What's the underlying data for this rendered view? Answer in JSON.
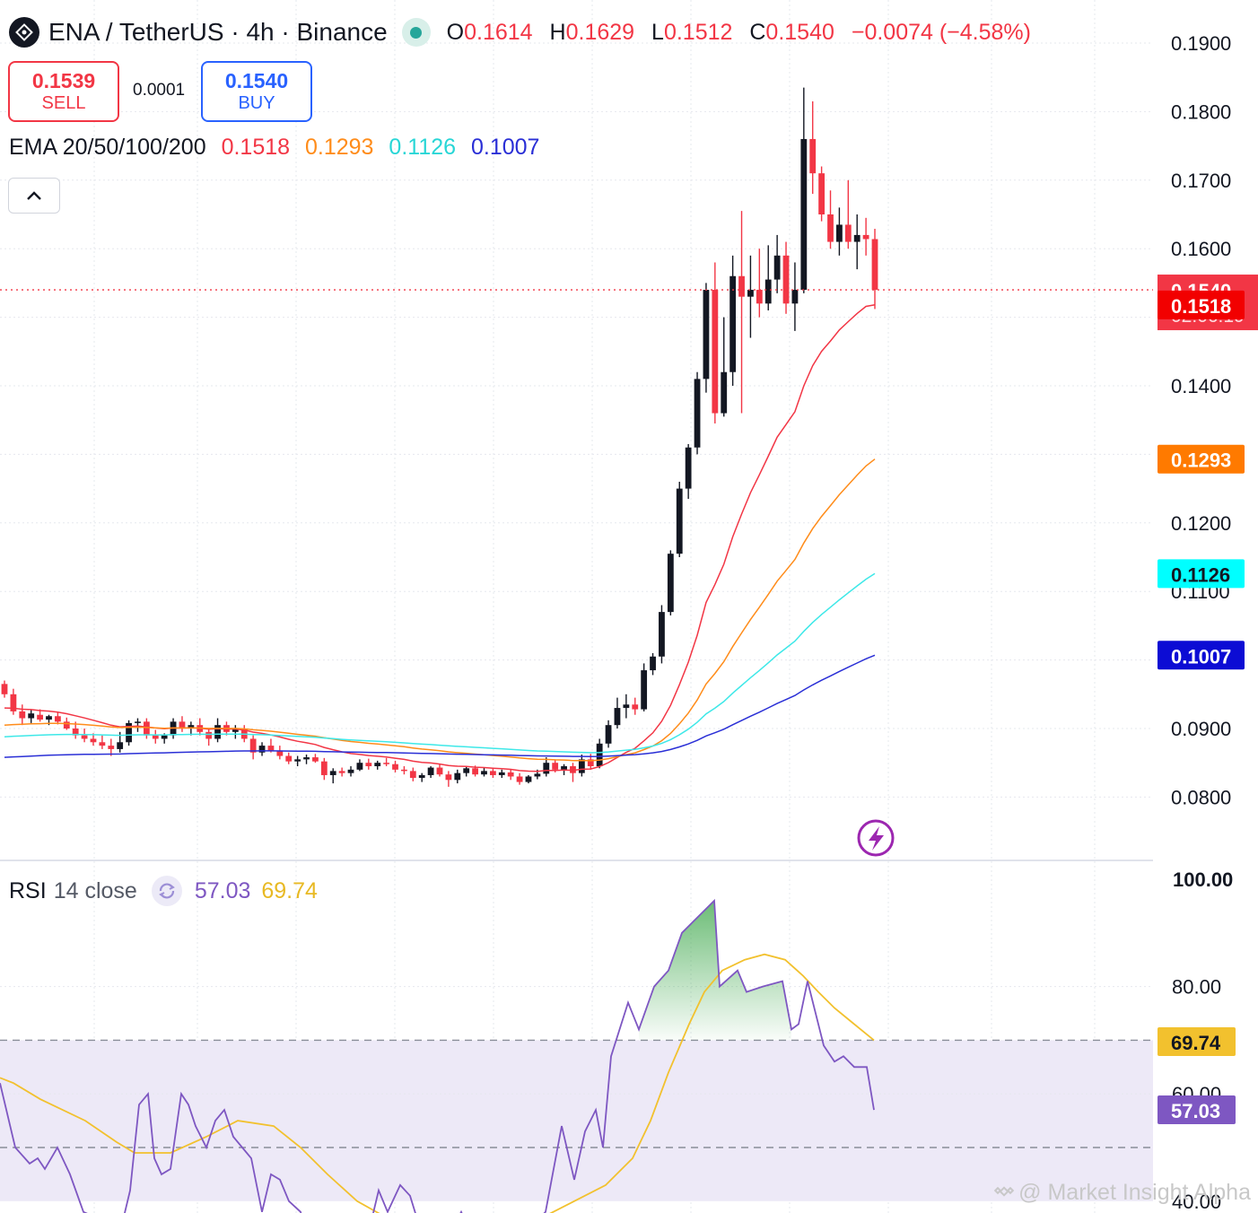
{
  "header": {
    "symbol": "ENA",
    "pair": "ENA / TetherUS · 4h · Binance",
    "ohlc": [
      {
        "k": "O",
        "v": "0.1614"
      },
      {
        "k": "H",
        "v": "0.1629"
      },
      {
        "k": "L",
        "v": "0.1512"
      },
      {
        "k": "C",
        "v": "0.1540"
      }
    ],
    "change": "−0.0074 (−4.58%)"
  },
  "trade": {
    "sell_price": "0.1539",
    "sell_label": "SELL",
    "spread": "0.0001",
    "buy_price": "0.1540",
    "buy_label": "BUY"
  },
  "ema_legend": {
    "label": "EMA 20/50/100/200",
    "values": [
      "0.1518",
      "0.1293",
      "0.1126",
      "0.1007"
    ]
  },
  "rsi_legend": {
    "name": "RSI",
    "args": "14 close",
    "rsi": "57.03",
    "ma": "69.74"
  },
  "watermark": "@ Market Insight Alpha",
  "colors": {
    "up": "#131722",
    "down": "#f23645",
    "ema20": "#f23645",
    "ema50": "#ff8c1a",
    "ema100": "#3ee8e8",
    "ema200": "#2a2fd6",
    "rsi": "#7e57c2",
    "rsi_ma": "#f2c12e",
    "rsi_band": "#ede9f7"
  },
  "icons": [
    "exchange-logo-icon",
    "status-dot-icon",
    "chevron-up-icon",
    "refresh-icon",
    "lightning-icon",
    "binance-logo-icon"
  ],
  "chart_data": [
    {
      "type": "candlestick",
      "ylim": [
        0.073,
        0.195
      ],
      "yticks": [
        "0.1900",
        "0.1800",
        "0.1700",
        "0.1600",
        "0.1400",
        "0.1200",
        "0.1100",
        "0.0900",
        "0.0800"
      ],
      "price_badges": [
        {
          "label": "0.1540",
          "sub": "02:06:19",
          "value": 0.154,
          "color": "#f23645"
        },
        {
          "label": "0.1518",
          "value": 0.1518,
          "color": "#f20000"
        },
        {
          "label": "0.1293",
          "value": 0.1293,
          "color": "#ff7a00"
        },
        {
          "label": "0.1126",
          "value": 0.1126,
          "color": "#00ffff"
        },
        {
          "label": "0.1007",
          "value": 0.1007,
          "color": "#0c0cd4"
        }
      ],
      "candles_ohlc": [
        [
          0.0965,
          0.097,
          0.0945,
          0.095
        ],
        [
          0.095,
          0.0958,
          0.092,
          0.0925
        ],
        [
          0.0925,
          0.0935,
          0.0905,
          0.0915
        ],
        [
          0.0915,
          0.0928,
          0.0908,
          0.0922
        ],
        [
          0.092,
          0.0928,
          0.091,
          0.0913
        ],
        [
          0.0913,
          0.092,
          0.0905,
          0.0918
        ],
        [
          0.0918,
          0.0924,
          0.0906,
          0.091
        ],
        [
          0.091,
          0.0916,
          0.0898,
          0.09
        ],
        [
          0.09,
          0.091,
          0.0885,
          0.089
        ],
        [
          0.089,
          0.09,
          0.088,
          0.0885
        ],
        [
          0.0885,
          0.0893,
          0.0875,
          0.088
        ],
        [
          0.088,
          0.089,
          0.087,
          0.0875
        ],
        [
          0.0875,
          0.0885,
          0.086,
          0.087
        ],
        [
          0.087,
          0.0895,
          0.0865,
          0.088
        ],
        [
          0.088,
          0.0912,
          0.0875,
          0.0908
        ],
        [
          0.0908,
          0.0915,
          0.0895,
          0.091
        ],
        [
          0.091,
          0.0915,
          0.0885,
          0.089
        ],
        [
          0.089,
          0.0898,
          0.0878,
          0.0885
        ],
        [
          0.0885,
          0.0893,
          0.0878,
          0.089
        ],
        [
          0.089,
          0.0915,
          0.0885,
          0.091
        ],
        [
          0.091,
          0.0918,
          0.0895,
          0.09
        ],
        [
          0.09,
          0.091,
          0.089,
          0.0905
        ],
        [
          0.0905,
          0.0915,
          0.089,
          0.0895
        ],
        [
          0.0895,
          0.09,
          0.0875,
          0.0885
        ],
        [
          0.0885,
          0.0915,
          0.088,
          0.0905
        ],
        [
          0.0905,
          0.091,
          0.089,
          0.0895
        ],
        [
          0.0895,
          0.0905,
          0.0885,
          0.09
        ],
        [
          0.09,
          0.0905,
          0.088,
          0.0885
        ],
        [
          0.0885,
          0.089,
          0.0855,
          0.0865
        ],
        [
          0.0865,
          0.088,
          0.086,
          0.0875
        ],
        [
          0.0875,
          0.0885,
          0.0865,
          0.0868
        ],
        [
          0.0868,
          0.0875,
          0.0855,
          0.086
        ],
        [
          0.086,
          0.0865,
          0.0848,
          0.0852
        ],
        [
          0.0852,
          0.086,
          0.0845,
          0.0855
        ],
        [
          0.0855,
          0.0862,
          0.0848,
          0.0858
        ],
        [
          0.0858,
          0.0863,
          0.085,
          0.0852
        ],
        [
          0.0852,
          0.0857,
          0.0825,
          0.0832
        ],
        [
          0.0832,
          0.0842,
          0.082,
          0.0838
        ],
        [
          0.0838,
          0.0843,
          0.083,
          0.0835
        ],
        [
          0.0835,
          0.0845,
          0.083,
          0.084
        ],
        [
          0.084,
          0.0855,
          0.0838,
          0.085
        ],
        [
          0.085,
          0.0856,
          0.084,
          0.0845
        ],
        [
          0.0845,
          0.0853,
          0.084,
          0.085
        ],
        [
          0.085,
          0.0857,
          0.0845,
          0.0848
        ],
        [
          0.0848,
          0.0853,
          0.0836,
          0.084
        ],
        [
          0.084,
          0.0845,
          0.0833,
          0.0838
        ],
        [
          0.0838,
          0.0843,
          0.0823,
          0.0828
        ],
        [
          0.0828,
          0.0835,
          0.0822,
          0.0832
        ],
        [
          0.0832,
          0.0845,
          0.0828,
          0.0843
        ],
        [
          0.0843,
          0.0848,
          0.083,
          0.0833
        ],
        [
          0.0833,
          0.0838,
          0.0815,
          0.0825
        ],
        [
          0.0825,
          0.084,
          0.082,
          0.0835
        ],
        [
          0.0835,
          0.0845,
          0.083,
          0.0842
        ],
        [
          0.0842,
          0.0846,
          0.083,
          0.0833
        ],
        [
          0.0833,
          0.0843,
          0.083,
          0.0838
        ],
        [
          0.0838,
          0.0843,
          0.0828,
          0.0832
        ],
        [
          0.0832,
          0.084,
          0.0828,
          0.0836
        ],
        [
          0.0836,
          0.084,
          0.0825,
          0.083
        ],
        [
          0.083,
          0.0835,
          0.0818,
          0.0822
        ],
        [
          0.0822,
          0.0832,
          0.082,
          0.083
        ],
        [
          0.083,
          0.084,
          0.0826,
          0.0834
        ],
        [
          0.0834,
          0.0858,
          0.083,
          0.085
        ],
        [
          0.085,
          0.0855,
          0.0836,
          0.084
        ],
        [
          0.084,
          0.0848,
          0.0832,
          0.0845
        ],
        [
          0.0845,
          0.085,
          0.0822,
          0.0835
        ],
        [
          0.0835,
          0.0862,
          0.083,
          0.0855
        ],
        [
          0.0855,
          0.0863,
          0.084,
          0.0845
        ],
        [
          0.0845,
          0.0885,
          0.0842,
          0.0878
        ],
        [
          0.0878,
          0.0912,
          0.0872,
          0.0905
        ],
        [
          0.0905,
          0.0945,
          0.09,
          0.093
        ],
        [
          0.093,
          0.095,
          0.0915,
          0.0935
        ],
        [
          0.0935,
          0.0945,
          0.092,
          0.0928
        ],
        [
          0.0928,
          0.0995,
          0.0925,
          0.0985
        ],
        [
          0.0985,
          0.101,
          0.0978,
          0.1005
        ],
        [
          0.1005,
          0.108,
          0.0995,
          0.107
        ],
        [
          0.107,
          0.116,
          0.1065,
          0.1155
        ],
        [
          0.1155,
          0.126,
          0.115,
          0.125
        ],
        [
          0.125,
          0.1315,
          0.1235,
          0.131
        ],
        [
          0.131,
          0.142,
          0.13,
          0.141
        ],
        [
          0.141,
          0.155,
          0.139,
          0.154
        ],
        [
          0.154,
          0.158,
          0.1345,
          0.136
        ],
        [
          0.136,
          0.15,
          0.1355,
          0.142
        ],
        [
          0.142,
          0.159,
          0.14,
          0.156
        ],
        [
          0.156,
          0.1655,
          0.136,
          0.153
        ],
        [
          0.153,
          0.159,
          0.147,
          0.154
        ],
        [
          0.154,
          0.16,
          0.15,
          0.152
        ],
        [
          0.152,
          0.1605,
          0.151,
          0.1555
        ],
        [
          0.1555,
          0.162,
          0.1535,
          0.159
        ],
        [
          0.159,
          0.161,
          0.1505,
          0.152
        ],
        [
          0.152,
          0.158,
          0.148,
          0.154
        ],
        [
          0.154,
          0.1835,
          0.1535,
          0.176
        ],
        [
          0.176,
          0.1815,
          0.168,
          0.171
        ],
        [
          0.171,
          0.172,
          0.164,
          0.165
        ],
        [
          0.165,
          0.1685,
          0.16,
          0.161
        ],
        [
          0.161,
          0.166,
          0.159,
          0.1635
        ],
        [
          0.1635,
          0.17,
          0.16,
          0.161
        ],
        [
          0.161,
          0.165,
          0.157,
          0.162
        ],
        [
          0.162,
          0.1645,
          0.159,
          0.1614
        ],
        [
          0.1614,
          0.1629,
          0.1512,
          0.154
        ]
      ],
      "ema": [
        {
          "name": "EMA 20",
          "color": "#f23645",
          "value": 0.1518
        },
        {
          "name": "EMA 50",
          "color": "#ff8c1a",
          "value": 0.1293
        },
        {
          "name": "EMA 100",
          "color": "#3ee8e8",
          "value": 0.1126
        },
        {
          "name": "EMA 200",
          "color": "#2a2fd6",
          "value": 0.1007
        }
      ]
    },
    {
      "type": "line",
      "title": "RSI 14 close",
      "ylim": [
        40,
        100
      ],
      "yticks": [
        "100.00",
        "80.00",
        "60.00",
        "40.00"
      ],
      "bands": [
        70,
        50
      ],
      "rsi_badge": {
        "label": "57.03",
        "value": 57.03,
        "color": "#7e57c2"
      },
      "ma_badge": {
        "label": "69.74",
        "value": 69.74,
        "color": "#f2c12e"
      },
      "rsi_values": [
        [
          0,
          62
        ],
        [
          17,
          50
        ],
        [
          33,
          47
        ],
        [
          42,
          48
        ],
        [
          50,
          46
        ],
        [
          64,
          50
        ],
        [
          78,
          45
        ],
        [
          93,
          38
        ],
        [
          106,
          37
        ],
        [
          118,
          36
        ],
        [
          135,
          35
        ],
        [
          145,
          42
        ],
        [
          155,
          58
        ],
        [
          165,
          60
        ],
        [
          172,
          48
        ],
        [
          180,
          45
        ],
        [
          190,
          46
        ],
        [
          202,
          60
        ],
        [
          210,
          58
        ],
        [
          218,
          54
        ],
        [
          230,
          50
        ],
        [
          240,
          55
        ],
        [
          250,
          57
        ],
        [
          260,
          52
        ],
        [
          270,
          50
        ],
        [
          280,
          48
        ],
        [
          292,
          38
        ],
        [
          302,
          45
        ],
        [
          312,
          44
        ],
        [
          322,
          40
        ],
        [
          335,
          38
        ],
        [
          345,
          32
        ],
        [
          355,
          35
        ],
        [
          372,
          33
        ],
        [
          385,
          30
        ],
        [
          395,
          33
        ],
        [
          412,
          35
        ],
        [
          422,
          42
        ],
        [
          432,
          38
        ],
        [
          446,
          43
        ],
        [
          457,
          41
        ],
        [
          468,
          35
        ],
        [
          478,
          33
        ],
        [
          490,
          32
        ],
        [
          502,
          34
        ],
        [
          514,
          38
        ],
        [
          525,
          34
        ],
        [
          540,
          30
        ],
        [
          552,
          32
        ],
        [
          566,
          35
        ],
        [
          578,
          33
        ],
        [
          590,
          35
        ],
        [
          608,
          38
        ],
        [
          626,
          54
        ],
        [
          640,
          44
        ],
        [
          652,
          53
        ],
        [
          664,
          57
        ],
        [
          672,
          50
        ],
        [
          681,
          67
        ],
        [
          700,
          77
        ],
        [
          712,
          72
        ],
        [
          729,
          80
        ],
        [
          745,
          83
        ],
        [
          760,
          90
        ],
        [
          772,
          92
        ],
        [
          796,
          96
        ],
        [
          802,
          80
        ],
        [
          822,
          83
        ],
        [
          832,
          79
        ],
        [
          850,
          80
        ],
        [
          872,
          81
        ],
        [
          882,
          72
        ],
        [
          890,
          73
        ],
        [
          900,
          81
        ],
        [
          918,
          69
        ],
        [
          930,
          66
        ],
        [
          940,
          67
        ],
        [
          952,
          65
        ],
        [
          966,
          65
        ],
        [
          974,
          57
        ]
      ],
      "ma_values": [
        [
          0,
          63
        ],
        [
          15,
          62
        ],
        [
          45,
          59
        ],
        [
          95,
          55
        ],
        [
          130,
          51
        ],
        [
          150,
          49
        ],
        [
          190,
          49
        ],
        [
          230,
          52
        ],
        [
          265,
          55
        ],
        [
          305,
          54
        ],
        [
          335,
          50
        ],
        [
          365,
          45
        ],
        [
          398,
          40
        ],
        [
          430,
          37
        ],
        [
          480,
          34
        ],
        [
          520,
          33
        ],
        [
          565,
          34
        ],
        [
          605,
          37
        ],
        [
          640,
          40
        ],
        [
          675,
          43
        ],
        [
          705,
          48
        ],
        [
          725,
          55
        ],
        [
          745,
          64
        ],
        [
          768,
          73
        ],
        [
          785,
          79
        ],
        [
          805,
          83
        ],
        [
          830,
          85
        ],
        [
          852,
          86
        ],
        [
          875,
          85
        ],
        [
          895,
          82
        ],
        [
          912,
          79
        ],
        [
          930,
          76
        ],
        [
          952,
          73
        ],
        [
          974,
          70
        ]
      ]
    }
  ]
}
